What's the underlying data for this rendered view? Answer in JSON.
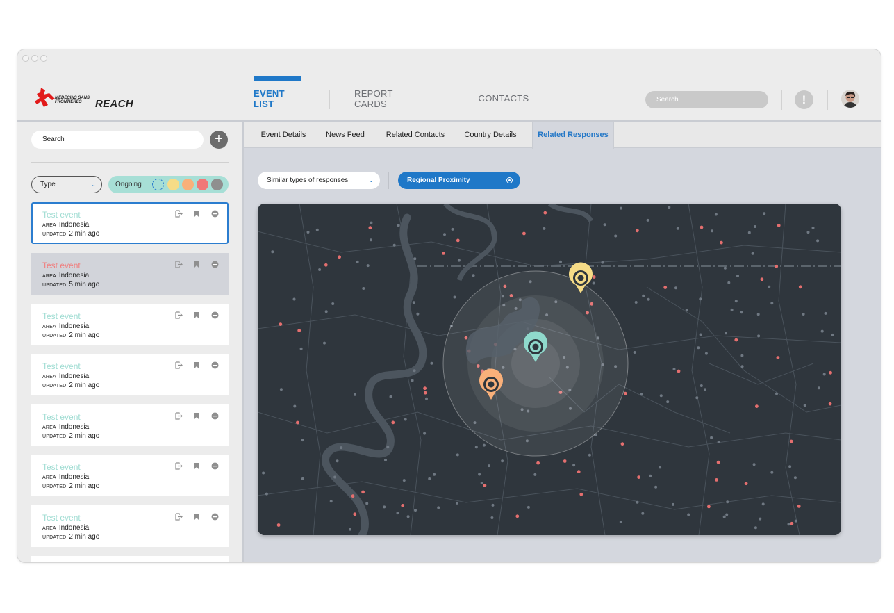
{
  "header": {
    "logo_brand": "REACH",
    "logo_org": "MEDECINS SANS FRONTIERES",
    "nav": [
      "EVENT LIST",
      "REPORT CARDS",
      "CONTACTS"
    ],
    "search_placeholder": "Search",
    "alert_symbol": "!"
  },
  "sidebar": {
    "search_placeholder": "Search",
    "add_symbol": "+",
    "type_filter": "Type",
    "status_filter": "Ongoing",
    "filter_colors": [
      "#a7dfd6",
      "#f6dc87",
      "#f9b07a",
      "#f07878",
      "#8f8f8f"
    ],
    "events": [
      {
        "title": "Test event",
        "area_label": "AREA",
        "area": "Indonesia",
        "updated_label": "UPDATED",
        "updated": "2 min ago"
      },
      {
        "title": "Test event",
        "area_label": "AREA",
        "area": "Indonesia",
        "updated_label": "UPDATED",
        "updated": "5 min ago"
      },
      {
        "title": "Test event",
        "area_label": "AREA",
        "area": "Indonesia",
        "updated_label": "UPDATED",
        "updated": "2 min ago"
      },
      {
        "title": "Test event",
        "area_label": "AREA",
        "area": "Indonesia",
        "updated_label": "UPDATED",
        "updated": "2 min ago"
      },
      {
        "title": "Test event",
        "area_label": "AREA",
        "area": "Indonesia",
        "updated_label": "UPDATED",
        "updated": "2 min ago"
      },
      {
        "title": "Test event",
        "area_label": "AREA",
        "area": "Indonesia",
        "updated_label": "UPDATED",
        "updated": "2 min ago"
      },
      {
        "title": "Test event",
        "area_label": "AREA",
        "area": "Indonesia",
        "updated_label": "UPDATED",
        "updated": "2 min ago"
      }
    ]
  },
  "main": {
    "tabs": [
      "Event Details",
      "News Feed",
      "Related Contacts",
      "Country Details",
      "Related Responses"
    ],
    "active_tab": "Related Responses",
    "response_filter": "Similar types of responses",
    "proximity_toggle": "Regional Proximity",
    "map_pins": [
      {
        "color": "#f6dc87",
        "kind": "nearby-response"
      },
      {
        "color": "#8fd9cc",
        "kind": "current-event"
      },
      {
        "color": "#f9b07a",
        "kind": "nearby-response"
      }
    ]
  },
  "colors": {
    "accent": "#1f78c8",
    "ongoing": "#a7dfd6",
    "alert": "#f07e7e",
    "map_bg": "#2f363d"
  }
}
